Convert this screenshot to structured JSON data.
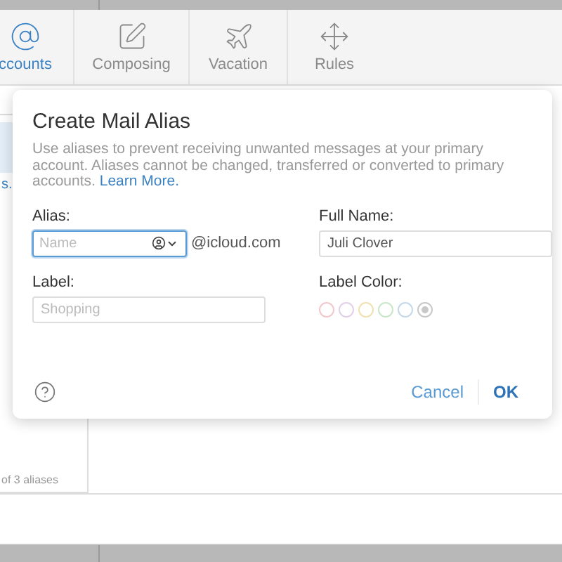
{
  "toolbar": {
    "tabs": [
      {
        "label": "ccounts",
        "selected": true,
        "kind": "at"
      },
      {
        "label": "Composing",
        "selected": false,
        "kind": "compose"
      },
      {
        "label": "Vacation",
        "selected": false,
        "kind": "plane"
      },
      {
        "label": "Rules",
        "selected": false,
        "kind": "move"
      }
    ]
  },
  "sidebar": {
    "item_text": "s.",
    "footer": "of 3 aliases"
  },
  "dialog": {
    "title": "Create Mail Alias",
    "description": "Use aliases to prevent receiving unwanted messages at your primary account. Aliases cannot be changed, transferred or converted to primary accounts.",
    "link": "Learn More.",
    "alias": {
      "label": "Alias:",
      "placeholder": "Name",
      "focused": true,
      "suffix": "@icloud.com"
    },
    "full_name": {
      "label": "Full Name:",
      "value": "Juli Clover"
    },
    "label": {
      "label": "Label:",
      "placeholder": "Shopping"
    },
    "label_color": {
      "label": "Label Color:",
      "colors": [
        {
          "color": "#f0c8cc",
          "selected": false
        },
        {
          "color": "#e2d0e8",
          "selected": false
        },
        {
          "color": "#eee2b0",
          "selected": false
        },
        {
          "color": "#c8e6c8",
          "selected": false
        },
        {
          "color": "#c4d8ea",
          "selected": false
        },
        {
          "color": "#c8c8c8",
          "selected": true
        }
      ]
    },
    "buttons": [
      {
        "label": "Cancel",
        "kind": "cancel"
      },
      {
        "label": "OK",
        "kind": "ok"
      }
    ]
  }
}
